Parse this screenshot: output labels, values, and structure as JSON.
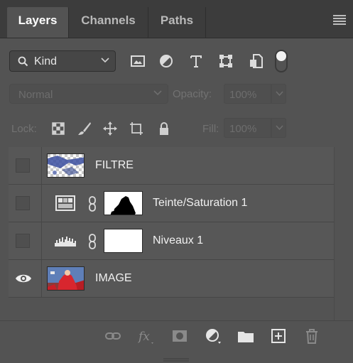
{
  "tabs": [
    {
      "label": "Layers",
      "active": true
    },
    {
      "label": "Channels",
      "active": false
    },
    {
      "label": "Paths",
      "active": false
    }
  ],
  "filter": {
    "kind_label": "Kind",
    "icons": [
      "pixel-layer-filter-icon",
      "adjustment-layer-filter-icon",
      "type-layer-filter-icon",
      "shape-layer-filter-icon",
      "smart-object-filter-icon",
      "filter-toggle-icon"
    ]
  },
  "blend": {
    "mode": "Normal",
    "opacity_label": "Opacity:",
    "opacity_value": "100%",
    "fill_label": "Fill:",
    "fill_value": "100%"
  },
  "lock": {
    "label": "Lock:",
    "icons": [
      "lock-transparent-pixels-icon",
      "lock-image-pixels-icon",
      "lock-position-icon",
      "lock-artboard-icon",
      "lock-all-icon"
    ]
  },
  "layers": [
    {
      "name": "FILTRE",
      "visible": false,
      "type": "pixel"
    },
    {
      "name": "Teinte/Saturation 1",
      "visible": false,
      "type": "hue-saturation"
    },
    {
      "name": "Niveaux 1",
      "visible": false,
      "type": "levels"
    },
    {
      "name": "IMAGE",
      "visible": true,
      "type": "pixel"
    }
  ],
  "bottom_icons": [
    "link-layers-icon",
    "fx-icon",
    "add-mask-icon",
    "new-adjustment-icon",
    "new-group-icon",
    "new-layer-icon",
    "delete-layer-icon"
  ],
  "colors": {
    "panel": "#535353",
    "tabbar": "#3c3c3c",
    "text": "#f0f0f0"
  }
}
